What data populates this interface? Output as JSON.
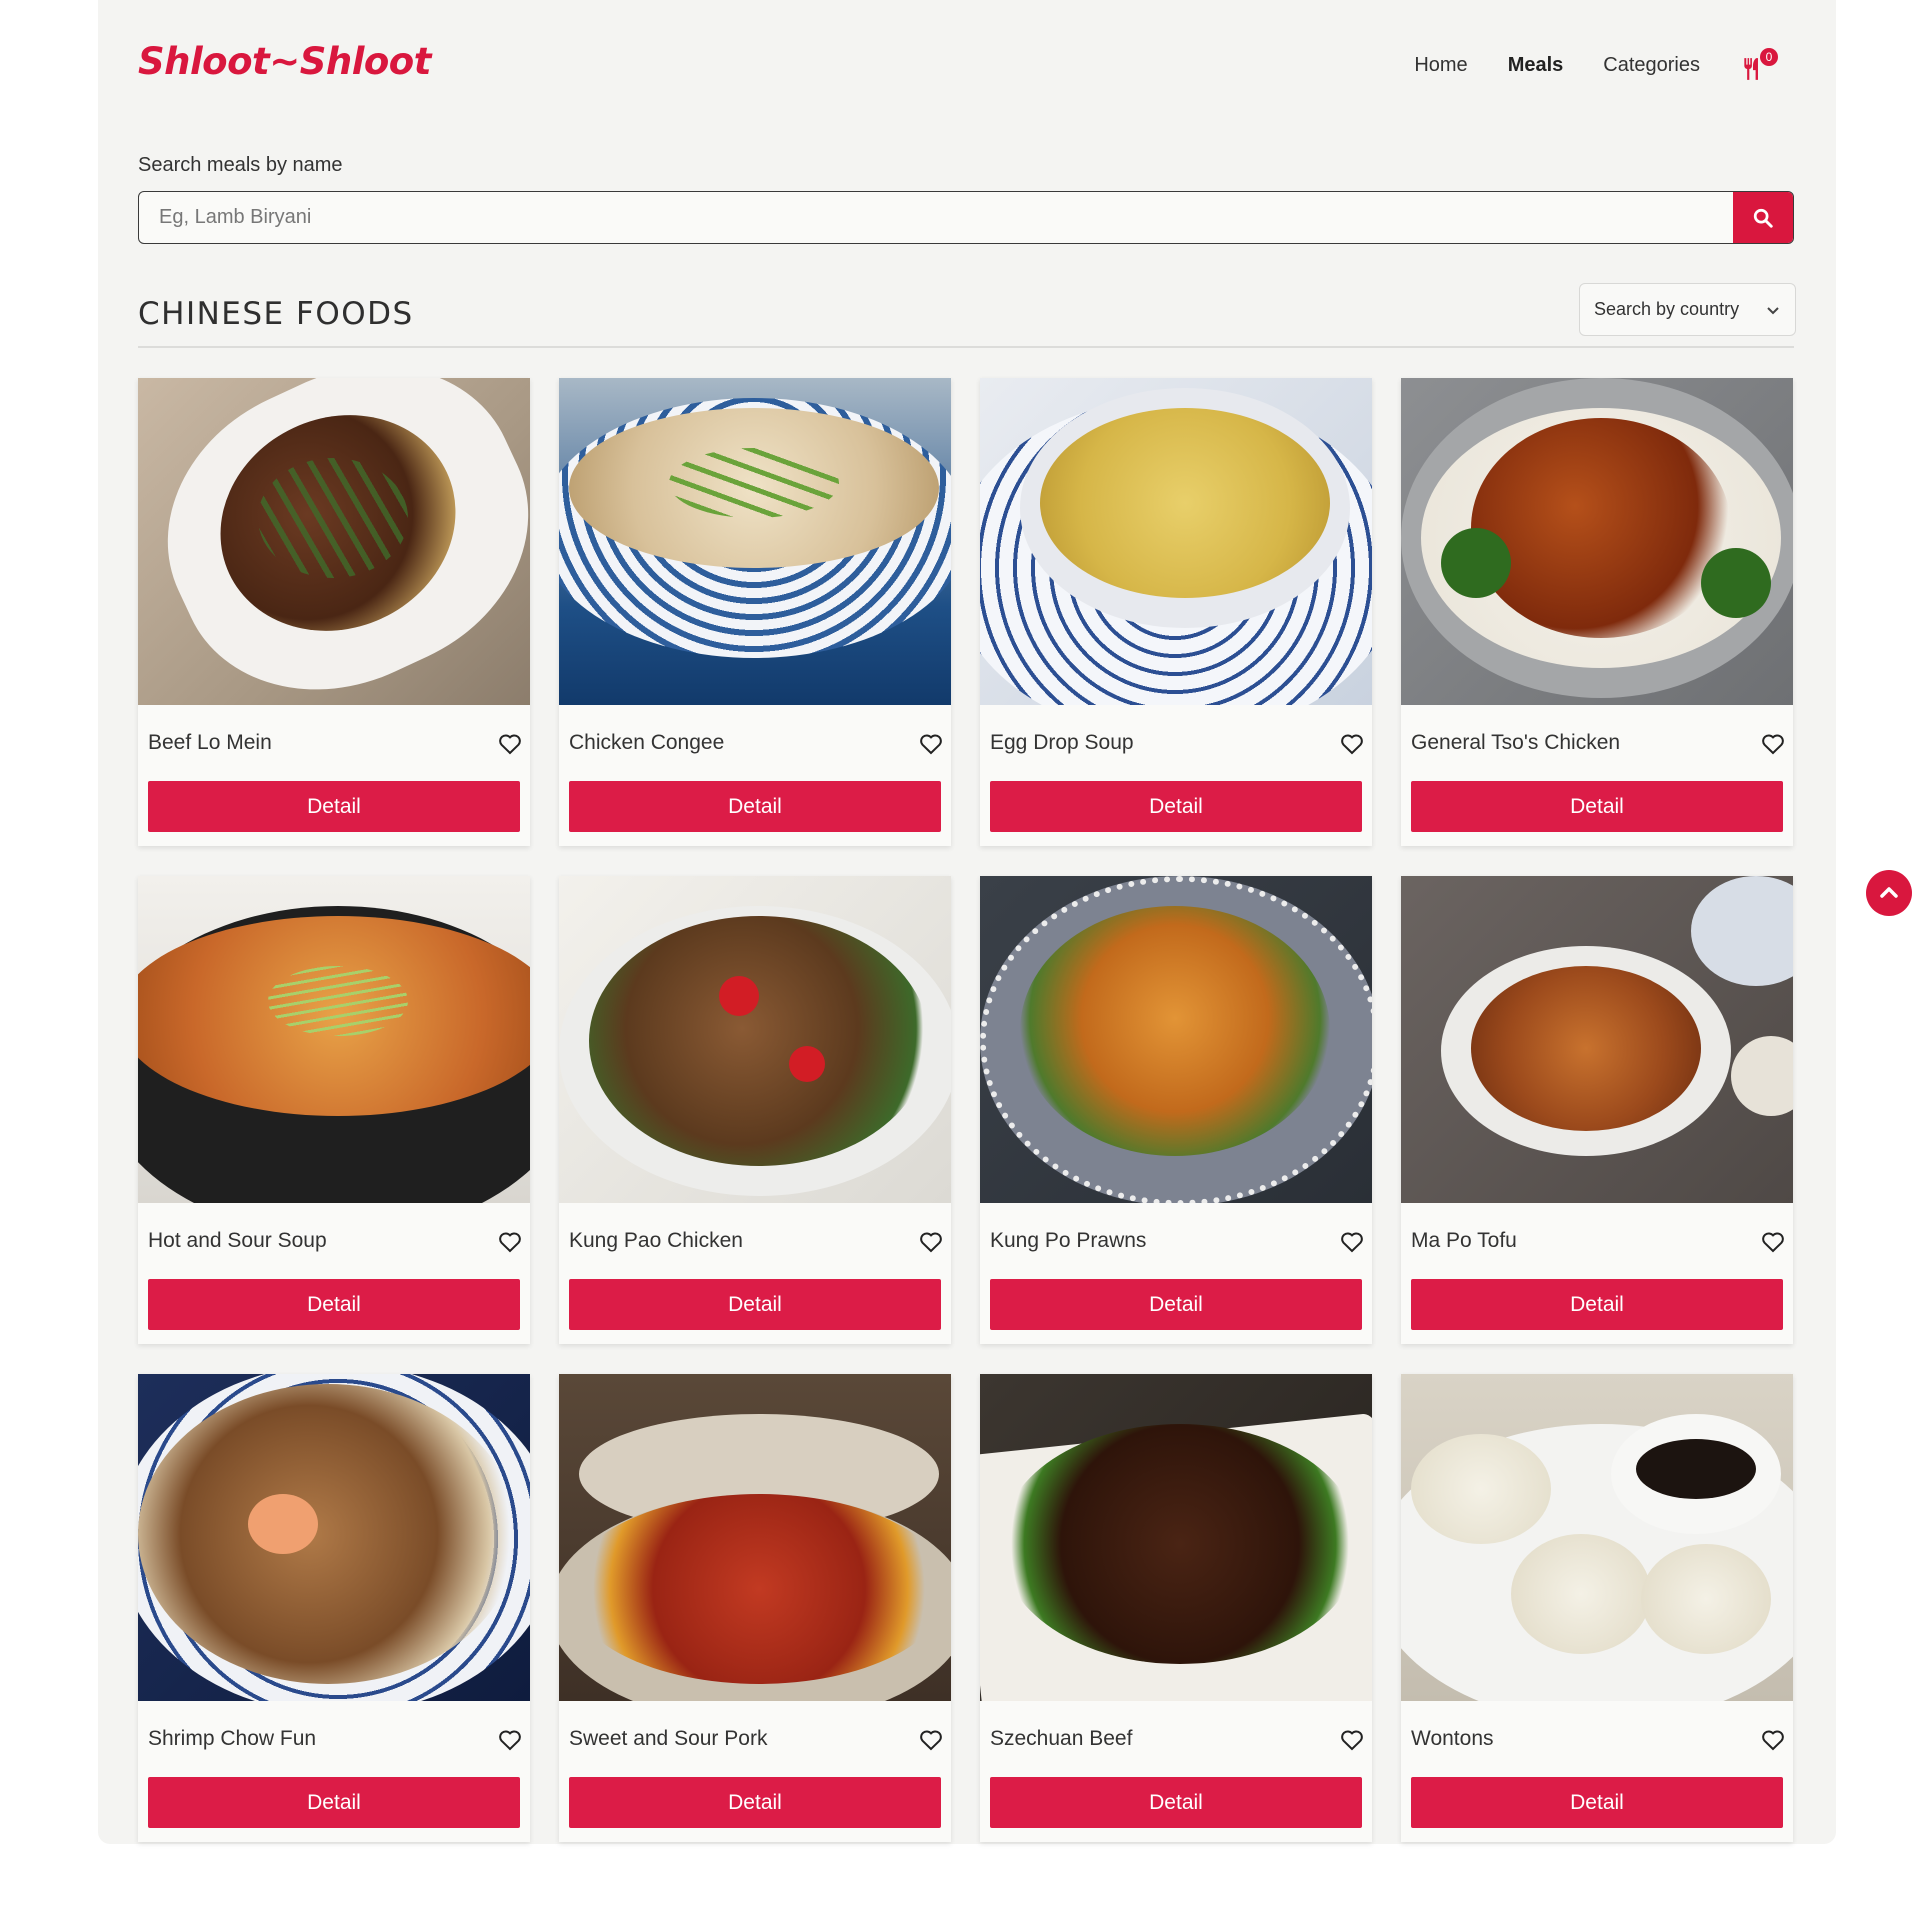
{
  "header": {
    "logo": "Shloot~Shloot",
    "nav": {
      "home": "Home",
      "meals": "Meals",
      "categories": "Categories"
    },
    "cart_count": "0"
  },
  "search": {
    "label": "Search meals by name",
    "placeholder": "Eg, Lamb Biryani"
  },
  "section": {
    "title": "CHINESE FOODS",
    "country_select": "Search by country"
  },
  "cards": [
    {
      "name": "Beef Lo Mein",
      "button": "Detail"
    },
    {
      "name": "Chicken Congee",
      "button": "Detail"
    },
    {
      "name": "Egg Drop Soup",
      "button": "Detail"
    },
    {
      "name": "General Tso's Chicken",
      "button": "Detail"
    },
    {
      "name": "Hot and Sour Soup",
      "button": "Detail"
    },
    {
      "name": "Kung Pao Chicken",
      "button": "Detail"
    },
    {
      "name": "Kung Po Prawns",
      "button": "Detail"
    },
    {
      "name": "Ma Po Tofu",
      "button": "Detail"
    },
    {
      "name": "Shrimp Chow Fun",
      "button": "Detail"
    },
    {
      "name": "Sweet and Sour Pork",
      "button": "Detail"
    },
    {
      "name": "Szechuan Beef",
      "button": "Detail"
    },
    {
      "name": "Wontons",
      "button": "Detail"
    }
  ],
  "colors": {
    "accent": "#d9173e",
    "page_bg": "#f4f4f2"
  },
  "icons": {
    "cart": "utensils-icon",
    "search": "search-icon",
    "favorite": "heart-icon",
    "scroll": "chevron-up-icon"
  }
}
